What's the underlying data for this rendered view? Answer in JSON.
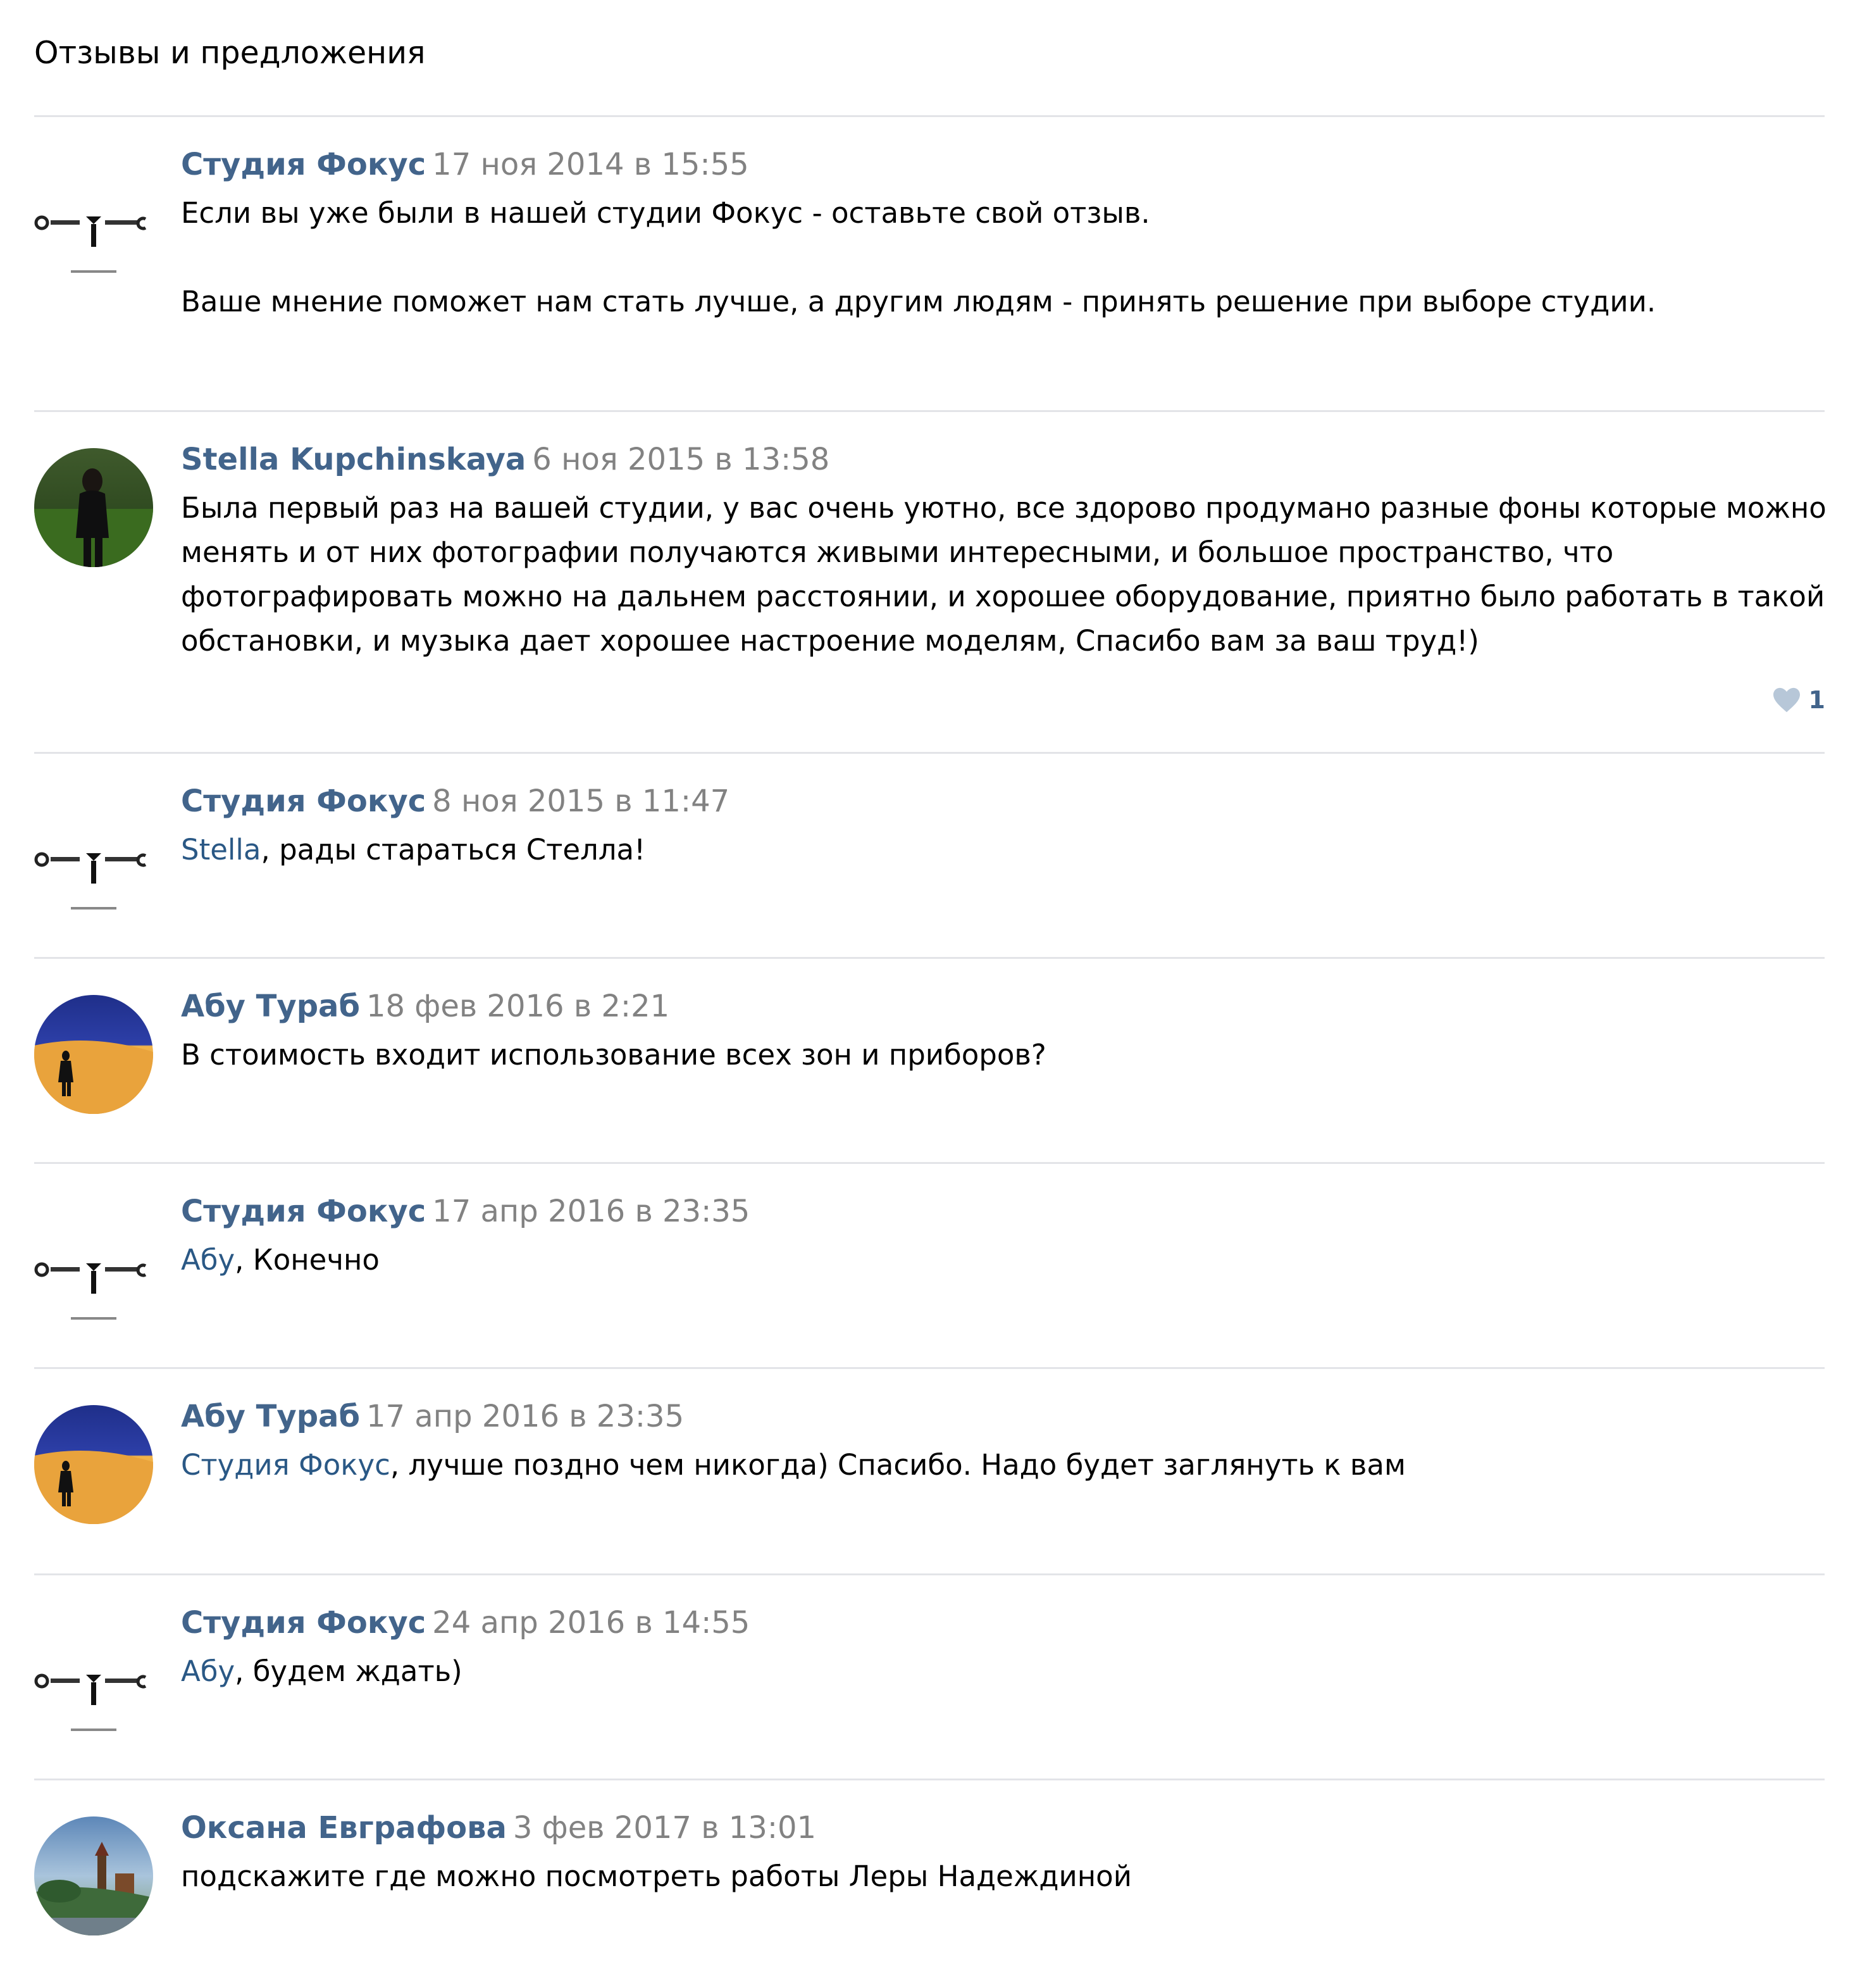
{
  "board": {
    "title": "Отзывы и предложения"
  },
  "posts": [
    {
      "author": "Студия Фокус",
      "date": "17 ноя 2014 в 15:55",
      "avatar_icon": "studio-logo-avatar",
      "lines": [
        "Если вы уже были в нашей студии Фокус - оставьте свой отзыв.",
        "",
        "Ваше мнение поможет нам стать лучше, а другим людям - принять решение при выборе студии."
      ]
    },
    {
      "author": "Stella Kupchinskaya",
      "date": "6 ноя 2015 в 13:58",
      "avatar_icon": "user-photo-avatar",
      "lines": [
        "Была первый раз на вашей студии, у вас очень уютно, все здорово продумано разные фоны которые можно",
        "менять и от них фотографии получаются живыми интересными, и большое пространство, что",
        "фотографировать можно на дальнем расстоянии, и хорошее оборудование, приятно было работать в такой",
        "обстановки, и музыка дает хорошее настроение моделям, Спасибо вам за ваш труд!)"
      ],
      "likes": "1"
    },
    {
      "author": "Студия Фокус",
      "date": "8 ноя 2015 в 11:47",
      "avatar_icon": "studio-logo-avatar",
      "mention": "Stella",
      "text": ", рады стараться Стелла!"
    },
    {
      "author": "Абу Тураб",
      "date": "18 фев 2016 в 2:21",
      "avatar_icon": "user-photo-avatar",
      "text": "В стоимость входит использование всех зон и приборов?"
    },
    {
      "author": "Студия Фокус",
      "date": "17 апр 2016 в 23:35",
      "avatar_icon": "studio-logo-avatar",
      "mention": "Абу",
      "text": ", Конечно"
    },
    {
      "author": "Абу Тураб",
      "date": "17 апр 2016 в 23:35",
      "avatar_icon": "user-photo-avatar",
      "mention": "Студия Фокус",
      "text": ", лучше поздно чем никогда) Спасибо. Надо будет заглянуть к вам"
    },
    {
      "author": "Студия Фокус",
      "date": "24 апр 2016 в 14:55",
      "avatar_icon": "studio-logo-avatar",
      "mention": "Абу",
      "text": ", будем ждать)"
    },
    {
      "author": "Оксана Евграфова",
      "date": "3 фев 2017 в 13:01",
      "avatar_icon": "user-photo-avatar",
      "text": "подскажите где можно посмотреть работы Леры Надеждиной"
    }
  ],
  "colors": {
    "author": "#42648b",
    "mention": "#2a5885",
    "date": "#828282",
    "divider": "#e3e4e8",
    "like_heart": "#b7c7d8"
  }
}
